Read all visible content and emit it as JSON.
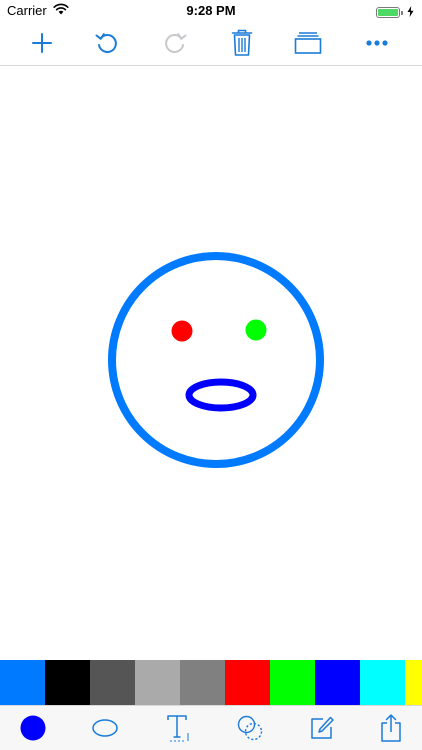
{
  "status_bar": {
    "carrier": "Carrier",
    "time": "9:28 PM",
    "icons": [
      "wifi-icon",
      "battery-icon",
      "charging-bolt-icon"
    ]
  },
  "top_toolbar": {
    "accent_color": "#1a7bd8",
    "disabled_color": "#c7c7cc",
    "buttons": [
      {
        "name": "add",
        "icon": "plus-icon",
        "enabled": true
      },
      {
        "name": "undo",
        "icon": "undo-icon",
        "enabled": true
      },
      {
        "name": "redo",
        "icon": "redo-icon",
        "enabled": false
      },
      {
        "name": "delete",
        "icon": "trash-icon",
        "enabled": true
      },
      {
        "name": "layers",
        "icon": "layers-icon",
        "enabled": true
      },
      {
        "name": "more",
        "icon": "more-icon",
        "enabled": true
      }
    ]
  },
  "canvas": {
    "drawing": "smiley-face",
    "shapes": [
      {
        "name": "face-outline",
        "color": "#007aff"
      },
      {
        "name": "left-eye",
        "color": "#ff0000"
      },
      {
        "name": "right-eye",
        "color": "#00ff00"
      },
      {
        "name": "mouth",
        "color": "#0000ff"
      }
    ]
  },
  "palette": {
    "colors": [
      "#007aff",
      "#000000",
      "#555555",
      "#aaaaaa",
      "#808080",
      "#ff0000",
      "#00ff00",
      "#0000ff",
      "#00ffff",
      "#ffff00"
    ]
  },
  "bottom_toolbar": {
    "current_color": "#0000ff",
    "tools": [
      {
        "name": "color",
        "icon": "color-dot-icon"
      },
      {
        "name": "ellipse",
        "icon": "ellipse-tool-icon"
      },
      {
        "name": "text",
        "icon": "text-tool-icon"
      },
      {
        "name": "selection",
        "icon": "selection-tool-icon"
      },
      {
        "name": "edit",
        "icon": "edit-icon"
      },
      {
        "name": "share",
        "icon": "share-icon"
      }
    ]
  }
}
